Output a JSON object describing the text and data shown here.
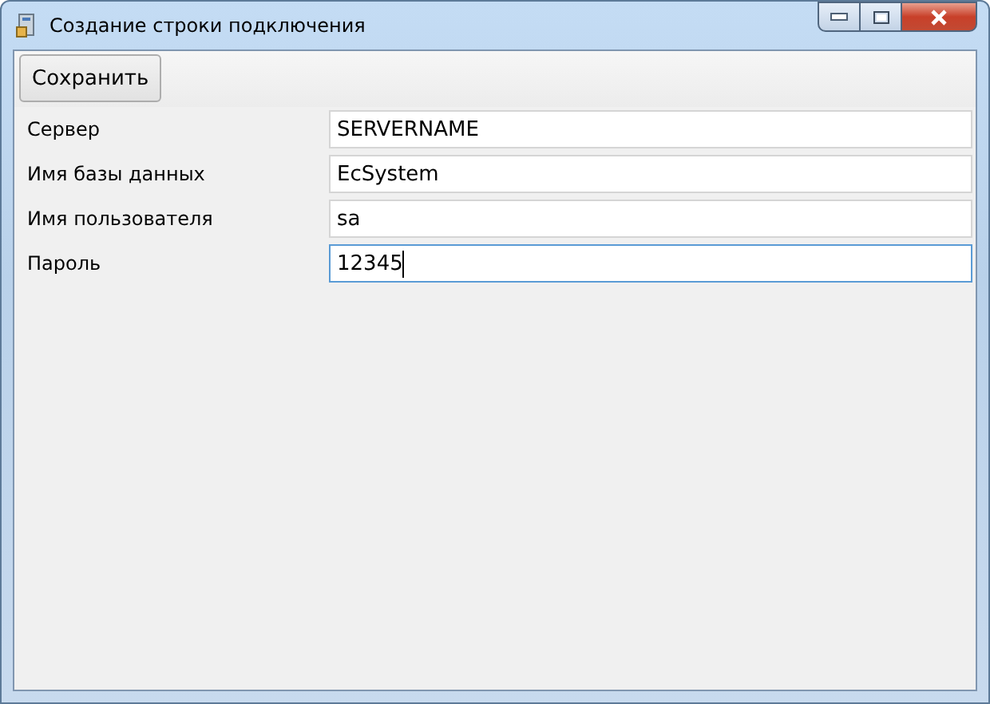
{
  "window": {
    "title": "Создание строки подключения"
  },
  "toolbar": {
    "save_button": "Сохранить"
  },
  "fields": [
    {
      "label": "Сервер",
      "value": "SERVERNAME",
      "focused": false
    },
    {
      "label": "Имя базы данных",
      "value": "EcSystem",
      "focused": false
    },
    {
      "label": "Имя пользователя",
      "value": "sa",
      "focused": false
    },
    {
      "label": "Пароль",
      "value": "12345",
      "focused": true
    }
  ]
}
